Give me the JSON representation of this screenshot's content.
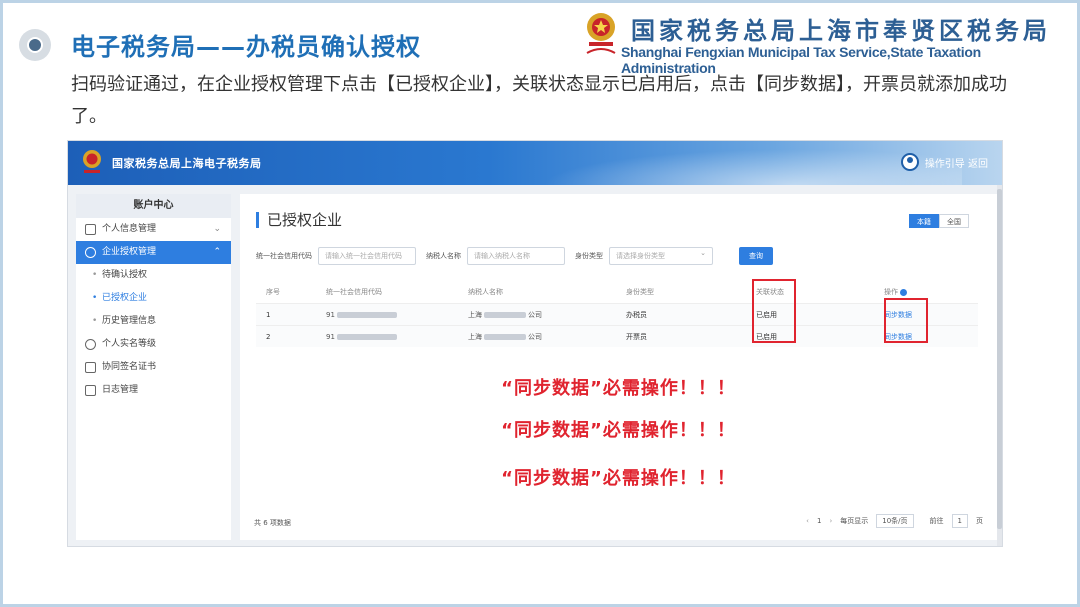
{
  "slide": {
    "title": "电子税务局——办税员确认授权",
    "org_cn": "国家税务总局上海市奉贤区税务局",
    "org_en": "Shanghai Fengxian Municipal Tax Service,State Taxation Administration",
    "description": "扫码验证通过，在企业授权管理下点击【已授权企业】，关联状态显示已启用后，点击【同步数据】，开票员就添加成功了。",
    "warning_text": "“同步数据”必需操作！！！"
  },
  "app": {
    "title": "国家税务总局上海电子税务局",
    "user_links": "操作引导 返回",
    "accent_color": "#2e7ee0",
    "highlight_color": "#e0242f"
  },
  "sidebar": {
    "header": "账户中心",
    "items": [
      {
        "label": "个人信息管理",
        "icon": "id-card-icon"
      },
      {
        "label": "企业授权管理",
        "icon": "check-circle-icon"
      },
      {
        "label": "待确认授权"
      },
      {
        "label": "已授权企业"
      },
      {
        "label": "历史管理信息"
      },
      {
        "label": "个人实名等级",
        "icon": "user-icon"
      },
      {
        "label": "协同签名证书",
        "icon": "certificate-icon"
      },
      {
        "label": "日志管理",
        "icon": "log-icon"
      }
    ]
  },
  "main": {
    "title": "已授权企业",
    "segments": [
      "本籍",
      "全国"
    ],
    "filters": {
      "credit_code_label": "统一社会信用代码",
      "credit_code_placeholder": "请输入统一社会信用代码",
      "taxpayer_label": "纳税人名称",
      "taxpayer_placeholder": "请输入纳税人名称",
      "identity_label": "身份类型",
      "identity_placeholder": "请选择身份类型",
      "query_button": "查询"
    },
    "table": {
      "columns": [
        "序号",
        "统一社会信用代码",
        "纳税人名称",
        "身份类型",
        "关联状态",
        "操作"
      ],
      "rows": [
        {
          "index": "1",
          "code_prefix": "91",
          "name_prefix": "上海",
          "name_suffix": "公司",
          "identity": "办税员",
          "status": "已启用",
          "action": "同步数据"
        },
        {
          "index": "2",
          "code_prefix": "91",
          "name_prefix": "上海",
          "name_suffix": "公司",
          "identity": "开票员",
          "status": "已启用",
          "action": "同步数据"
        }
      ]
    },
    "footer": {
      "total": "共 6 项数据",
      "page": "1",
      "page_size_label": "每页显示",
      "page_size": "10条/页",
      "goto_label": "前往",
      "goto_value": "1",
      "page_unit": "页"
    }
  }
}
